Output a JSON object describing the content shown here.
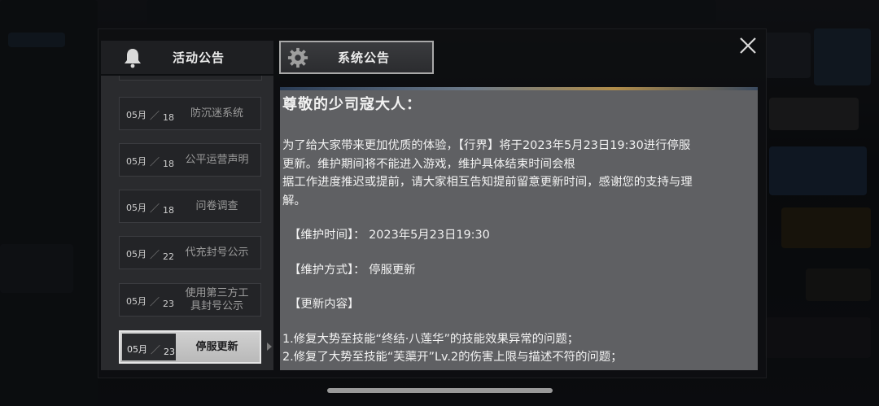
{
  "tabs": {
    "activity": {
      "label": "活动公告",
      "icon": "bell-icon"
    },
    "system": {
      "label": "系统公告",
      "icon": "gear-icon"
    }
  },
  "announcements": [
    {
      "month": "05月",
      "day": "18",
      "title": "防沉迷系统"
    },
    {
      "month": "05月",
      "day": "18",
      "title": "公平运营声明"
    },
    {
      "month": "05月",
      "day": "18",
      "title": "问卷调查"
    },
    {
      "month": "05月",
      "day": "22",
      "title": "代充封号公示"
    },
    {
      "month": "05月",
      "day": "23",
      "title": "使用第三方工具封号公示"
    },
    {
      "month": "05月",
      "day": "23",
      "title": "停服更新",
      "selected": true
    }
  ],
  "content": {
    "heading": "尊敬的少司寇大人：",
    "intro_lines": [
      "为了给大家带来更加优质的体验，【行界】将于2023年5月23日19:30进行停服",
      "更新。维护期间将不能进入游戏，维护具体结束时间会根",
      "据工作进度推迟或提前，请大家相互告知提前留意更新时间，感谢您的支持与理",
      "解。"
    ],
    "maintenance_time": "【维护时间】： 2023年5月23日19:30",
    "maintenance_method": "【维护方式】： 停服更新",
    "update_heading": "【更新内容】",
    "update_items": [
      "1.修复大势至技能“终结·八莲华”的技能效果异常的问题；",
      "2.修复了大势至技能“芙蕖开”Lv.2的伤害上限与描述不符的问题；"
    ]
  },
  "colors": {
    "content_bg": "#5f6063",
    "list_bg": "#2a2b2e",
    "active_item": "#c8c8c8"
  }
}
